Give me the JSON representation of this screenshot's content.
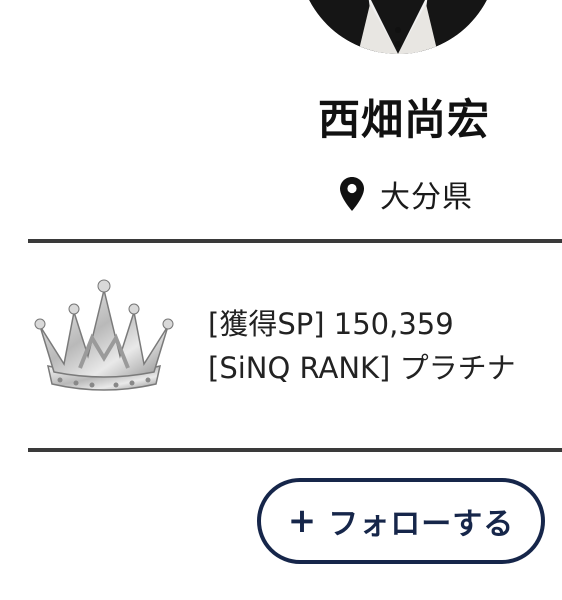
{
  "profile": {
    "name": "西畑尚宏",
    "location": "大分県"
  },
  "stats": {
    "points_text": "[獲得SP] 150,359",
    "rank_text": "[SiNQ RANK] プラチナ",
    "rank_icon": "crown-icon"
  },
  "actions": {
    "follow_plus": "+",
    "follow_label": "フォローする"
  },
  "icons": {
    "location": "location-pin-icon",
    "avatar": "avatar-photo"
  },
  "colors": {
    "accent": "#16264a",
    "divider": "#3a3a3a",
    "text": "#111111"
  }
}
